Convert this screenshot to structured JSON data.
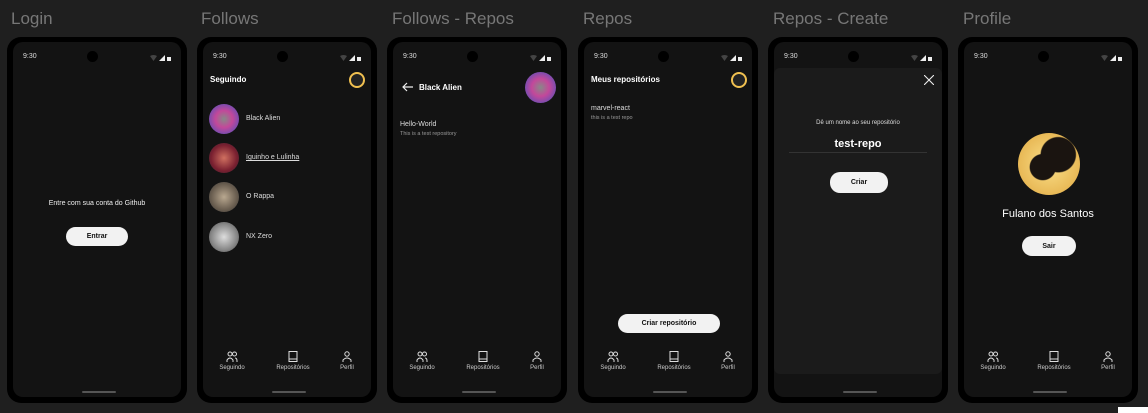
{
  "status_time": "9:30",
  "frames": {
    "login": {
      "title": "Login",
      "prompt": "Entre com sua conta do Github",
      "button": "Entrar"
    },
    "follows": {
      "title": "Follows",
      "header": "Seguindo",
      "items": [
        "Black Alien",
        "Iguinho e Lulinha",
        "O Rappa",
        "NX Zero"
      ]
    },
    "follows_repos": {
      "title": "Follows - Repos",
      "header": "Black Alien",
      "repo_name": "Hello-World",
      "repo_desc": "This is a test repository"
    },
    "repos": {
      "title": "Repos",
      "header": "Meus repositórios",
      "repo_name": "marvel-react",
      "repo_desc": "this is a test repo",
      "button": "Criar repositório"
    },
    "repos_create": {
      "title": "Repos - Create",
      "label": "Dê um nome ao seu repositório",
      "input_value": "test-repo",
      "button": "Criar"
    },
    "profile": {
      "title": "Profile",
      "name": "Fulano dos Santos",
      "button": "Sair"
    }
  },
  "nav": {
    "following": "Seguindo",
    "repos": "Repositórios",
    "profile": "Perfil"
  },
  "colors": {
    "canvas": "#1f1f1f",
    "screen": "#131313",
    "accent": "#f0c050"
  }
}
